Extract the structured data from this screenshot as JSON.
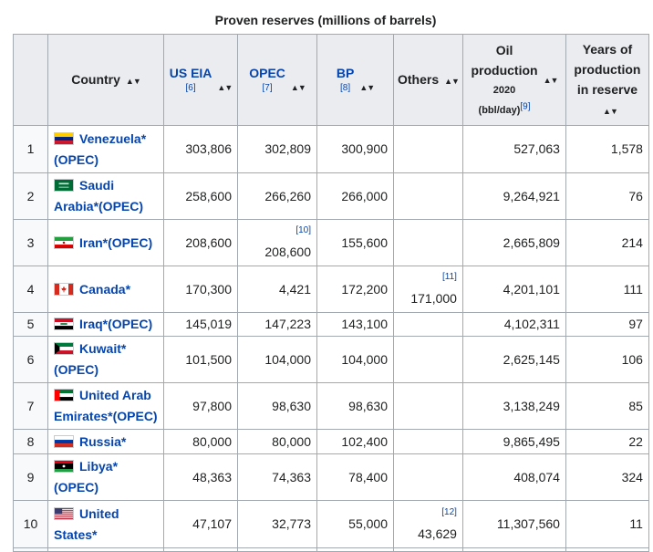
{
  "caption": "Proven reserves (millions of barrels)",
  "headers": {
    "country": "Country",
    "us_eia": "US EIA",
    "us_eia_ref": "[6]",
    "opec": "OPEC",
    "opec_ref": "[7]",
    "bp": "BP",
    "bp_ref": "[8]",
    "others": "Others",
    "oil_l1": "Oil",
    "oil_l2": "production",
    "oil_l3": "2020",
    "oil_unit": "(bbl/day)",
    "oil_ref": "[9]",
    "years_l1": "Years of",
    "years_l2": "production",
    "years_l3": "in reserve"
  },
  "rows": [
    {
      "rank": "1",
      "name_a": "Venezuela*",
      "name_b": "(OPEC)",
      "flag": "venezuela-flag-icon",
      "eia": "303,806",
      "opec": "302,809",
      "bp": "300,900",
      "others": "",
      "prod": "527,063",
      "years": "1,578"
    },
    {
      "rank": "2",
      "name_a": "Saudi",
      "name_b": "Arabia*(OPEC)",
      "flag": "saudi-arabia-flag-icon",
      "eia": "258,600",
      "opec": "266,260",
      "bp": "266,000",
      "others": "",
      "prod": "9,264,921",
      "years": "76"
    },
    {
      "rank": "3",
      "name_a": "Iran*(OPEC)",
      "name_b": "",
      "flag": "iran-flag-icon",
      "eia": "208,600",
      "opec": "208,600",
      "opec_ref": "[10]",
      "bp": "155,600",
      "others": "",
      "prod": "2,665,809",
      "years": "214"
    },
    {
      "rank": "4",
      "name_a": "Canada*",
      "name_b": "",
      "flag": "canada-flag-icon",
      "eia": "170,300",
      "opec": "4,421",
      "bp": "172,200",
      "others": "171,000",
      "others_ref": "[11]",
      "prod": "4,201,101",
      "years": "111"
    },
    {
      "rank": "5",
      "name_a": "Iraq*(OPEC)",
      "name_b": "",
      "flag": "iraq-flag-icon",
      "eia": "145,019",
      "opec": "147,223",
      "bp": "143,100",
      "others": "",
      "prod": "4,102,311",
      "years": "97"
    },
    {
      "rank": "6",
      "name_a": "Kuwait*",
      "name_b": "(OPEC)",
      "flag": "kuwait-flag-icon",
      "eia": "101,500",
      "opec": "104,000",
      "bp": "104,000",
      "others": "",
      "prod": "2,625,145",
      "years": "106"
    },
    {
      "rank": "7",
      "name_a": "United Arab",
      "name_b": "Emirates*(OPEC)",
      "flag": "uae-flag-icon",
      "eia": "97,800",
      "opec": "98,630",
      "bp": "98,630",
      "others": "",
      "prod": "3,138,249",
      "years": "85"
    },
    {
      "rank": "8",
      "name_a": "Russia*",
      "name_b": "",
      "flag": "russia-flag-icon",
      "eia": "80,000",
      "opec": "80,000",
      "bp": "102,400",
      "others": "",
      "prod": "9,865,495",
      "years": "22"
    },
    {
      "rank": "9",
      "name_a": "Libya*",
      "name_b": "(OPEC)",
      "flag": "libya-flag-icon",
      "eia": "48,363",
      "opec": "74,363",
      "bp": "78,400",
      "others": "",
      "prod": "408,074",
      "years": "324"
    },
    {
      "rank": "10",
      "name_a": "United",
      "name_b": "States*",
      "flag": "usa-flag-icon",
      "eia": "47,107",
      "opec": "32,773",
      "bp": "55,000",
      "others": "43,629",
      "others_ref": "[12]",
      "prod": "11,307,560",
      "years": "11"
    }
  ],
  "sort_icon": "sort-updown-icon"
}
